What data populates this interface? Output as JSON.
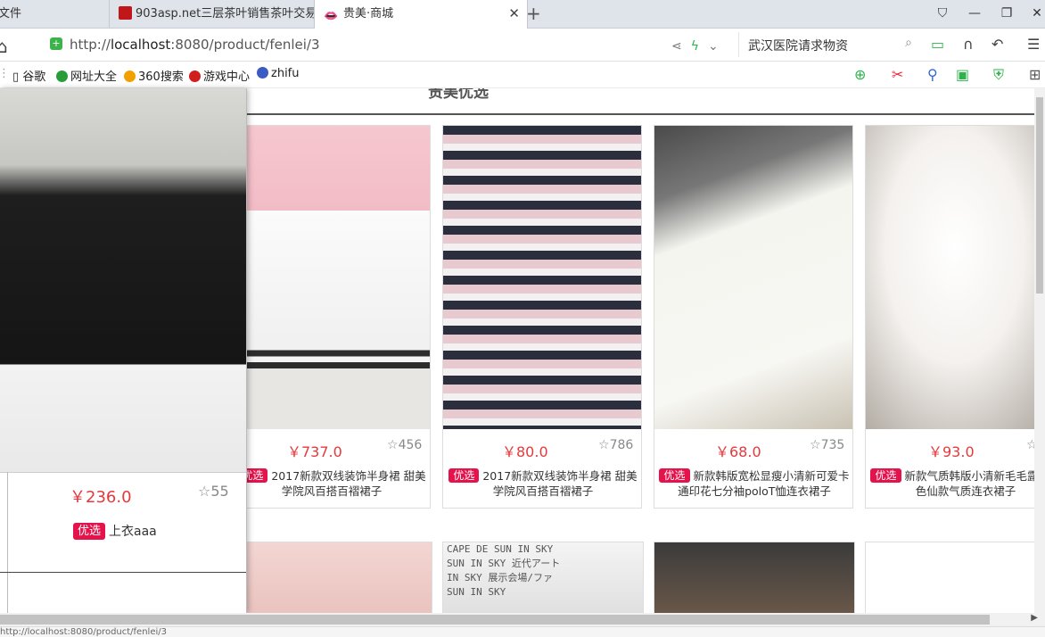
{
  "browser": {
    "tabs": [
      {
        "label": "文件"
      },
      {
        "label": "903asp.net三层茶叶销售茶叶交易"
      },
      {
        "label": "贵美·商城"
      }
    ],
    "url_prefix": "http://",
    "url_host": "localhost",
    "url_rest": ":8080/product/fenlei/3",
    "search_text": "武汉医院请求物资",
    "bookmarks": [
      "谷歌",
      "网址大全",
      "360搜索",
      "游戏中心",
      "zhifu"
    ]
  },
  "page": {
    "section_title": "贵美优选",
    "badge_label": "优选",
    "products": [
      {
        "price": "￥737.0",
        "rating": "456",
        "desc": "2017新款双线装饰半身裙 甜美学院风百搭百褶裙子"
      },
      {
        "price": "￥80.0",
        "rating": "786",
        "desc": "2017新款双线装饰半身裙 甜美学院风百搭百褶裙子"
      },
      {
        "price": "￥68.0",
        "rating": "735",
        "desc": "新款韩版宽松显瘦小清新可爱卡通印花七分袖poloT恤连衣裙子"
      },
      {
        "price": "￥93.0",
        "rating": "",
        "desc": "新款气质韩版小清新毛毛露肩纯色仙款气质连衣裙子"
      }
    ],
    "featured": {
      "price": "￥236.0",
      "rating": "55",
      "desc": "上衣aaa"
    },
    "row2_text": [
      "CAPE DE SUN IN SKY",
      "SUN IN SKY 近代アート",
      "IN SKY 展示会場/ファ",
      "SUN IN SKY"
    ]
  },
  "status": {
    "text": "http://localhost:8080/product/fenlei/3"
  }
}
